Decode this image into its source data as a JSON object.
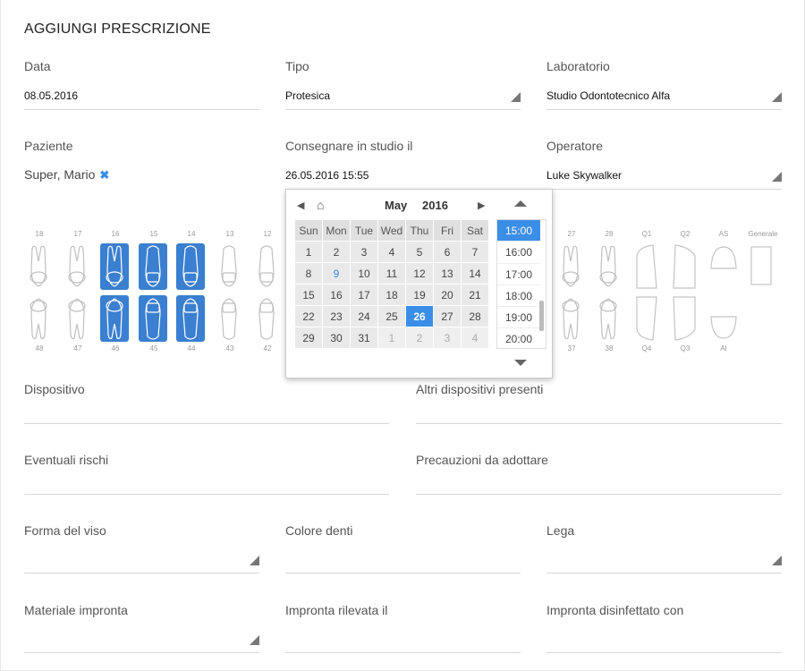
{
  "form": {
    "title": "AGGIUNGI PRESCRIZIONE",
    "data": {
      "label": "Data",
      "value": "08.05.2016"
    },
    "tipo": {
      "label": "Tipo",
      "value": "Protesica"
    },
    "laboratorio": {
      "label": "Laboratorio",
      "value": "Studio Odontotecnico Alfa"
    },
    "paziente": {
      "label": "Paziente",
      "value": "Super, Mario"
    },
    "consegnare": {
      "label": "Consegnare in studio il",
      "value": "26.05.2016 15:55"
    },
    "operatore": {
      "label": "Operatore",
      "value": "Luke Skywalker"
    },
    "dispositivo": {
      "label": "Dispositivo",
      "value": ""
    },
    "altri": {
      "label": "Altri dispositivi presenti",
      "value": ""
    },
    "rischi": {
      "label": "Eventuali rischi",
      "value": ""
    },
    "precauzioni": {
      "label": "Precauzioni da adottare",
      "value": ""
    },
    "forma": {
      "label": "Forma del viso",
      "value": ""
    },
    "colore": {
      "label": "Colore denti",
      "value": ""
    },
    "lega": {
      "label": "Lega",
      "value": ""
    },
    "materiale": {
      "label": "Materiale impronta",
      "value": ""
    },
    "impronta_rilevata": {
      "label": "Impronta rilevata il",
      "value": ""
    },
    "impronta_disinfettato": {
      "label": "Impronta disinfettato con",
      "value": ""
    }
  },
  "teeth": {
    "upper_left": [
      "18",
      "17",
      "16",
      "15",
      "14",
      "13",
      "12"
    ],
    "lower_left": [
      "48",
      "47",
      "46",
      "45",
      "44",
      "43",
      "42"
    ],
    "upper_right": [
      "27",
      "28",
      "Q1",
      "Q2",
      "AS",
      "Generale"
    ],
    "lower_right": [
      "37",
      "38",
      "Q4",
      "Q3",
      "AI"
    ],
    "selected": [
      "16",
      "15",
      "14",
      "46",
      "45",
      "44"
    ],
    "selected_color": "#3a7fd0"
  },
  "calendar": {
    "month": "May",
    "year": "2016",
    "weekdays": [
      "Sun",
      "Mon",
      "Tue",
      "Wed",
      "Thu",
      "Fri",
      "Sat"
    ],
    "weeks": [
      [
        "1",
        "2",
        "3",
        "4",
        "5",
        "6",
        "7"
      ],
      [
        "8",
        "9",
        "10",
        "11",
        "12",
        "13",
        "14"
      ],
      [
        "15",
        "16",
        "17",
        "18",
        "19",
        "20",
        "21"
      ],
      [
        "22",
        "23",
        "24",
        "25",
        "26",
        "27",
        "28"
      ],
      [
        "29",
        "30",
        "31",
        "1",
        "2",
        "3",
        "4"
      ]
    ],
    "selected_day": "26",
    "highlighted_day": "9",
    "times": [
      "15:00",
      "16:00",
      "17:00",
      "18:00",
      "19:00",
      "20:00"
    ],
    "selected_time": "15:00",
    "accent": "#3a8ee6"
  }
}
